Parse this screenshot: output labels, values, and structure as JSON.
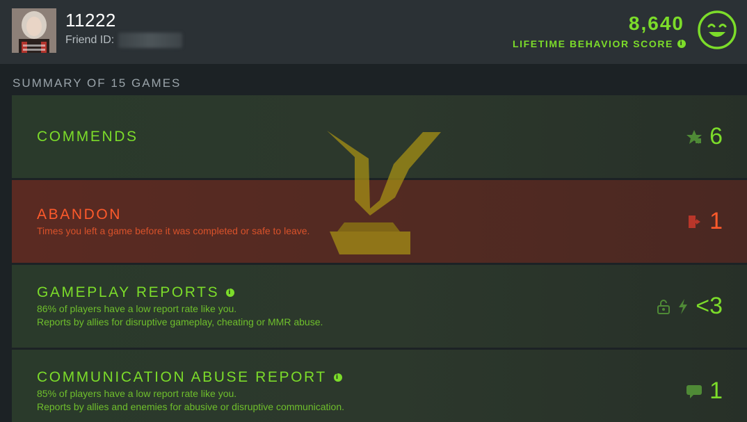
{
  "header": {
    "username": "11222",
    "friend_id_label": "Friend ID:",
    "score": "8,640",
    "score_label": "LIFETIME BEHAVIOR SCORE",
    "info_glyph": "i",
    "avatar_icon": "user-avatar",
    "status_icon": "smiley-face-icon"
  },
  "summary": {
    "title": "SUMMARY OF 15 GAMES",
    "cards": [
      {
        "title": "COMMENDS",
        "value": "6",
        "icon": "star-commend-icon",
        "style": "green"
      },
      {
        "title": "ABANDON",
        "subtitle": "Times you left a game before it was completed or safe to leave.",
        "value": "1",
        "icon": "exit-door-icon",
        "style": "red"
      },
      {
        "title": "GAMEPLAY REPORTS",
        "subtitle1": "86% of players have a low report rate like you.",
        "subtitle2": "Reports by allies for disruptive gameplay, cheating or MMR abuse.",
        "value": "<3",
        "icons": [
          "unlock-icon",
          "lightning-icon"
        ],
        "style": "green"
      },
      {
        "title": "COMMUNICATION ABUSE REPORT",
        "subtitle1": "85% of players have a low report rate like you.",
        "subtitle2": "Reports by allies and enemies for abusive or disruptive communication.",
        "value": "1",
        "icon": "chat-bubble-icon",
        "style": "green"
      }
    ]
  },
  "colors": {
    "accent_green": "#7cdc2a",
    "accent_red": "#ff5a2b",
    "watermark_gold": "#b89a1a"
  }
}
